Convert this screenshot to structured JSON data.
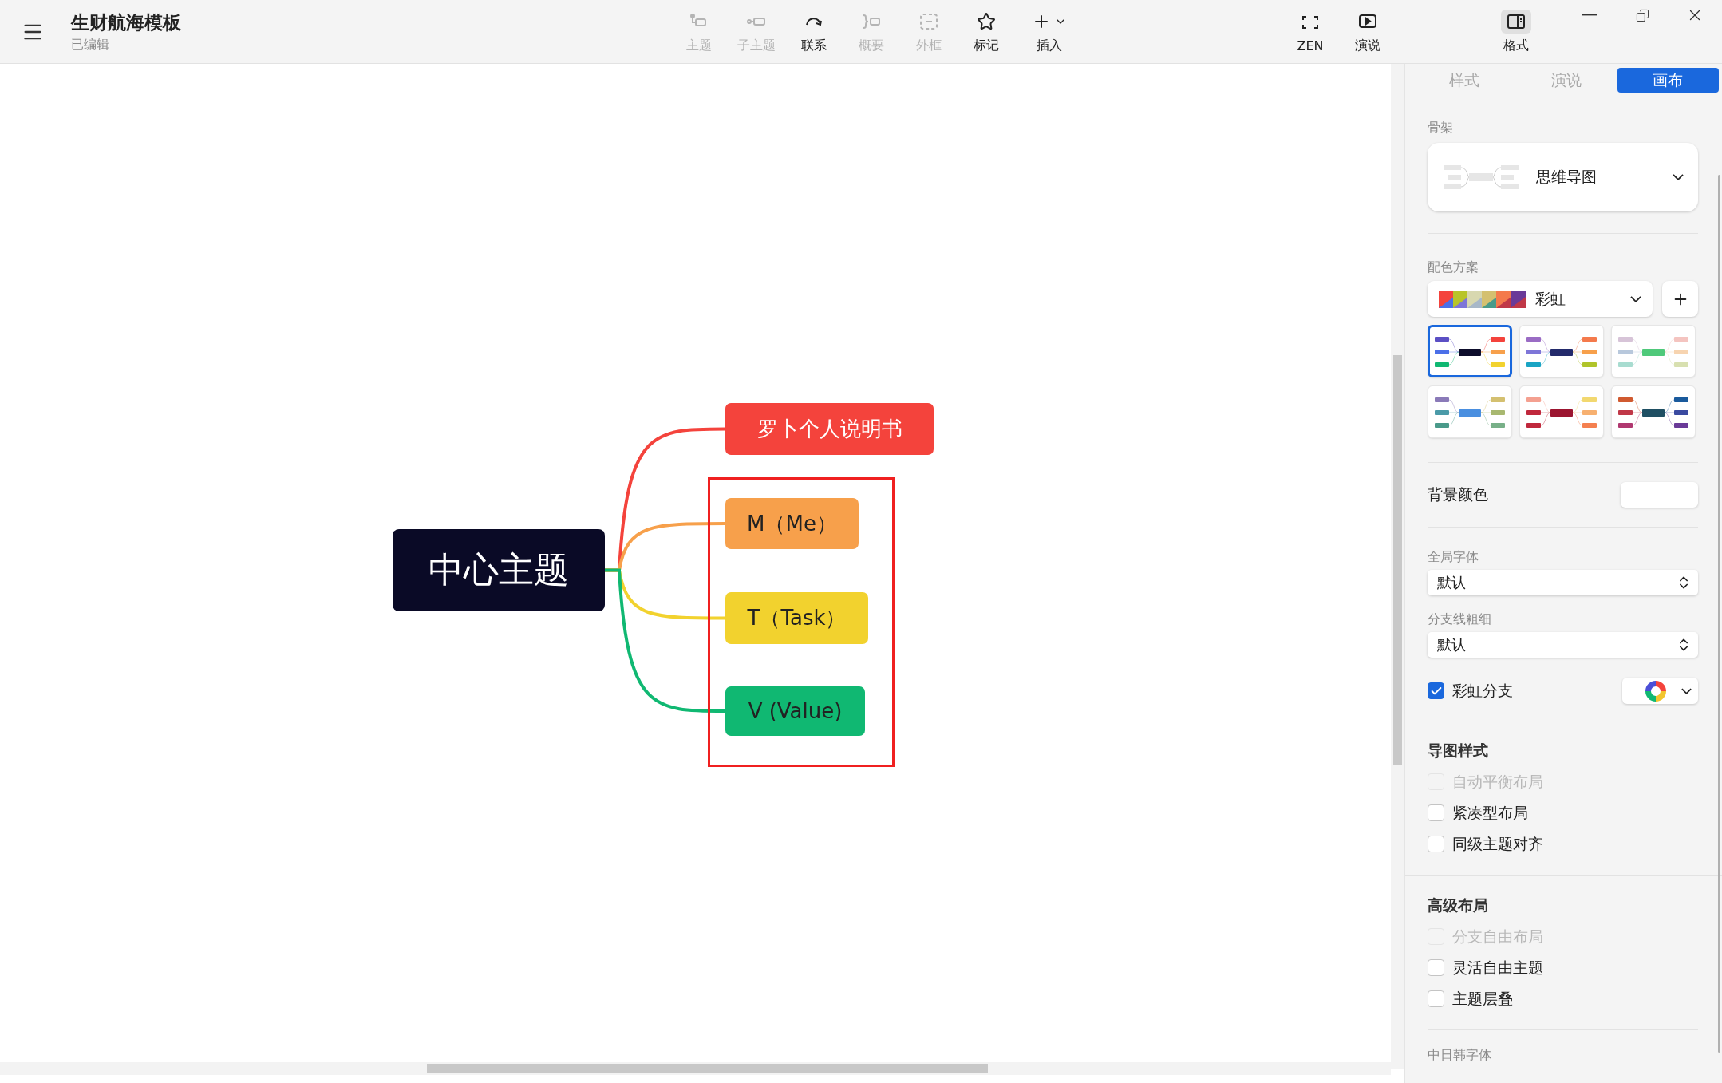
{
  "app": {
    "title": "生财航海模板",
    "subtitle": "已编辑"
  },
  "toolbar": [
    {
      "kind": "topic",
      "label": "主题",
      "disabled": true
    },
    {
      "kind": "subtopic",
      "label": "子主题",
      "disabled": true
    },
    {
      "kind": "relation",
      "label": "联系",
      "disabled": false
    },
    {
      "kind": "summary",
      "label": "概要",
      "disabled": true
    },
    {
      "kind": "boundary",
      "label": "外框",
      "disabled": true
    },
    {
      "kind": "marker",
      "label": "标记",
      "disabled": false
    },
    {
      "kind": "insert",
      "label": "插入",
      "disabled": false
    }
  ],
  "view_buttons": [
    {
      "kind": "zen",
      "label": "ZEN"
    },
    {
      "kind": "present",
      "label": "演说"
    }
  ],
  "format_button": {
    "label": "格式",
    "selected": true
  },
  "mindmap": {
    "central": "中心主题",
    "branches": [
      {
        "label": "罗卜个人说明书",
        "color": "#f4433c"
      },
      {
        "label": "M（Me）",
        "color": "#f7a04b"
      },
      {
        "label": "T（Task）",
        "color": "#f2d22e"
      },
      {
        "label": "V (Value)",
        "color": "#10b872"
      }
    ],
    "boundary_shown": true
  },
  "panel": {
    "tabs": [
      {
        "label": "样式",
        "selected": false
      },
      {
        "label": "演说",
        "selected": false
      },
      {
        "label": "画布",
        "selected": true
      }
    ],
    "skeleton": {
      "label": "骨架",
      "value": "思维导图"
    },
    "color_scheme": {
      "label": "配色方案",
      "value": "彩虹",
      "themes": [
        {
          "selected": true
        },
        {
          "selected": false
        },
        {
          "selected": false
        },
        {
          "selected": false
        },
        {
          "selected": false
        },
        {
          "selected": false
        }
      ]
    },
    "background": {
      "label": "背景颜色"
    },
    "global_font": {
      "label": "全局字体",
      "value": "默认"
    },
    "branch_width": {
      "label": "分支线粗细",
      "value": "默认"
    },
    "rainbow_branch": {
      "label": "彩虹分支",
      "checked": true
    },
    "sections": [
      {
        "title": "导图样式",
        "options": [
          {
            "label": "自动平衡布局",
            "checked": false,
            "disabled": true
          },
          {
            "label": "紧凑型布局",
            "checked": false,
            "disabled": false
          },
          {
            "label": "同级主题对齐",
            "checked": false,
            "disabled": false
          }
        ]
      },
      {
        "title": "高级布局",
        "options": [
          {
            "label": "分支自由布局",
            "checked": false,
            "disabled": true
          },
          {
            "label": "灵活自由主题",
            "checked": false,
            "disabled": false
          },
          {
            "label": "主题层叠",
            "checked": false,
            "disabled": false
          }
        ]
      }
    ],
    "cjk_font": {
      "label": "中日韩字体"
    }
  }
}
